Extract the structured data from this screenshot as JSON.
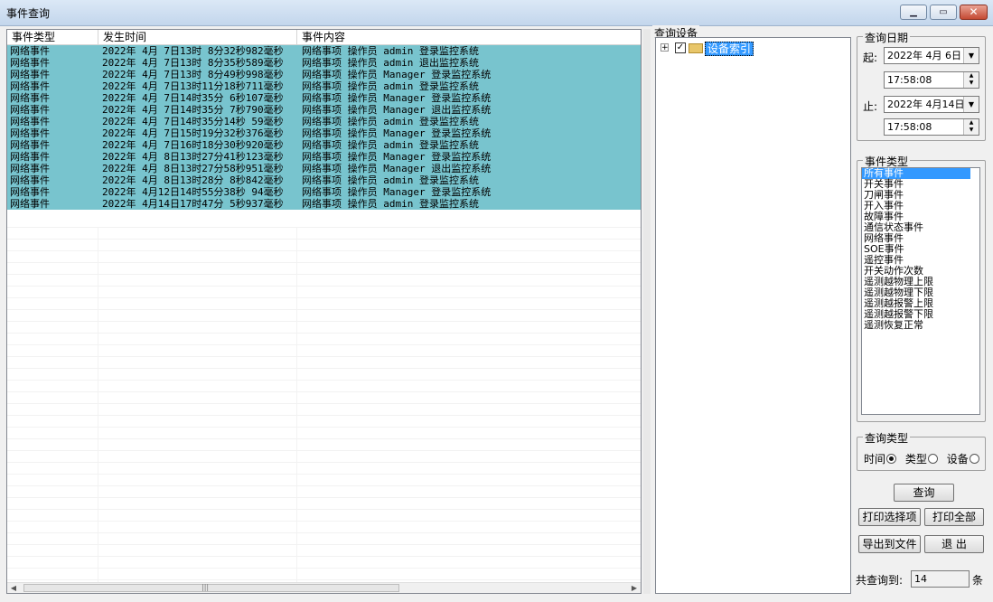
{
  "window": {
    "title": "事件查询"
  },
  "table": {
    "columns": [
      "事件类型",
      "发生时间",
      "事件内容"
    ],
    "rows": [
      [
        "网络事件",
        "2022年 4月 7日13时 8分32秒982毫秒",
        "网络事项 操作员 admin 登录监控系统"
      ],
      [
        "网络事件",
        "2022年 4月 7日13时 8分35秒589毫秒",
        "网络事项 操作员 admin 退出监控系统"
      ],
      [
        "网络事件",
        "2022年 4月 7日13时 8分49秒998毫秒",
        "网络事项 操作员 Manager 登录监控系统"
      ],
      [
        "网络事件",
        "2022年 4月 7日13时11分18秒711毫秒",
        "网络事项 操作员 admin 登录监控系统"
      ],
      [
        "网络事件",
        "2022年 4月 7日14时35分 6秒107毫秒",
        "网络事项 操作员 Manager 登录监控系统"
      ],
      [
        "网络事件",
        "2022年 4月 7日14时35分 7秒790毫秒",
        "网络事项 操作员 Manager 退出监控系统"
      ],
      [
        "网络事件",
        "2022年 4月 7日14时35分14秒 59毫秒",
        "网络事项 操作员 admin 登录监控系统"
      ],
      [
        "网络事件",
        "2022年 4月 7日15时19分32秒376毫秒",
        "网络事项 操作员 Manager 登录监控系统"
      ],
      [
        "网络事件",
        "2022年 4月 7日16时18分30秒920毫秒",
        "网络事项 操作员 admin 登录监控系统"
      ],
      [
        "网络事件",
        "2022年 4月 8日13时27分41秒123毫秒",
        "网络事项 操作员 Manager 登录监控系统"
      ],
      [
        "网络事件",
        "2022年 4月 8日13时27分58秒951毫秒",
        "网络事项 操作员 Manager 退出监控系统"
      ],
      [
        "网络事件",
        "2022年 4月 8日13时28分 8秒842毫秒",
        "网络事项 操作员 admin 登录监控系统"
      ],
      [
        "网络事件",
        "2022年 4月12日14时55分38秒 94毫秒",
        "网络事项 操作员 Manager 登录监控系统"
      ],
      [
        "网络事件",
        "2022年 4月14日17时47分 5秒937毫秒",
        "网络事项 操作员 admin 登录监控系统"
      ]
    ],
    "scroll_mark": "|||"
  },
  "device": {
    "legend": "查询设备",
    "node_label": "设备索引",
    "checked": true
  },
  "date": {
    "legend": "查询日期",
    "start_label": "起:",
    "start_date": "2022年 4月 6日",
    "start_time": "17:58:08",
    "end_label": "止:",
    "end_date": "2022年 4月14日",
    "end_time": "17:58:08"
  },
  "event_types": {
    "legend": "事件类型",
    "items": [
      "所有事件",
      "开关事件",
      "刀闸事件",
      "开入事件",
      "故障事件",
      "通信状态事件",
      "网络事件",
      "SOE事件",
      "遥控事件",
      "开关动作次数",
      "遥测越物理上限",
      "遥测越物理下限",
      "遥测越报警上限",
      "遥测越报警下限",
      "遥测恢复正常"
    ],
    "selected": 0
  },
  "query_type": {
    "legend": "查询类型",
    "options": [
      "时间",
      "类型",
      "设备"
    ],
    "selected": 0
  },
  "buttons": {
    "query": "查询",
    "print_selected": "打印选择项",
    "print_all": "打印全部",
    "export": "导出到文件",
    "exit": "退 出"
  },
  "count": {
    "label": "共查询到:",
    "value": "14",
    "unit": "条"
  }
}
